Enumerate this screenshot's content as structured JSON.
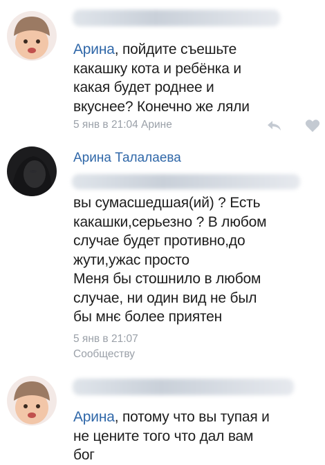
{
  "comments": [
    {
      "mention": "Арина",
      "body": ", пойдите съешьте\nкакашку кота и ребёнка и\nкакая будет роднее и\nвкуснее? Конечно же ляли",
      "meta": "5 янв в 21:04 Арине"
    },
    {
      "author": "Арина Талалаева",
      "body": "вы сумасшедшая(ий) ? Есть\nкакашки,серьезно ? В любом\nслучае будет противно,до\nжути,ужас просто\nМеня бы стошнило в любом\nслучае, ни один вид не был\nбы мнє более приятен",
      "meta": "5 янв в 21:07",
      "source": "Сообществу"
    },
    {
      "mention": "Арина",
      "body": ", потому что вы тупая и\nне цените того что дал вам\nбог"
    }
  ],
  "colors": {
    "link": "#2f67a8",
    "meta": "#9aa0a8",
    "blur": "#d3d9e1"
  },
  "icons": [
    "reply-icon",
    "heart-icon"
  ]
}
